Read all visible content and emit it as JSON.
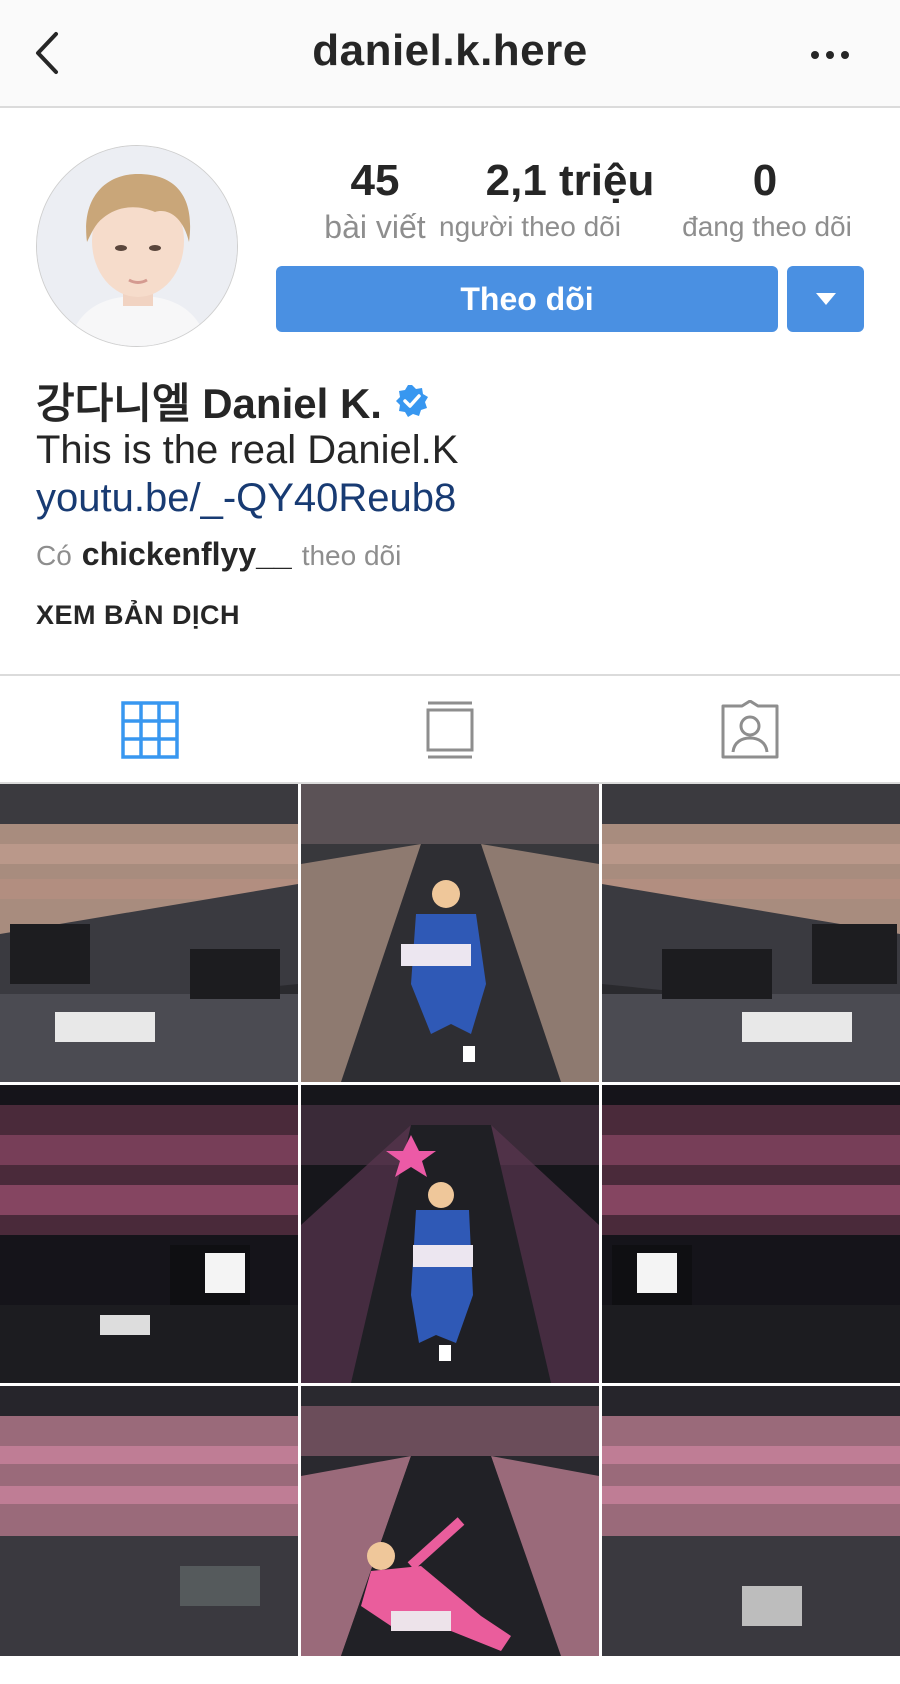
{
  "header": {
    "username": "daniel.k.here",
    "icons": {
      "back": "chevron-left-icon",
      "more": "more-horizontal-icon"
    }
  },
  "stats": {
    "posts": {
      "value": "45",
      "label": "bài viết"
    },
    "followers": {
      "value": "2,1 triệu",
      "label": "người theo dõi"
    },
    "following": {
      "value": "0",
      "label": "đang theo dõi"
    }
  },
  "actions": {
    "follow_label": "Theo dõi",
    "dropdown_icon": "caret-down-icon",
    "accent": "#4a90e2"
  },
  "profile": {
    "name": "강다니엘 Daniel K.",
    "verified_icon": "verified-badge-icon",
    "bio": "This is the real Daniel.K",
    "link": "youtu.be/_-QY40Reub8",
    "followed_prefix": "Có",
    "followed_user": "chickenflyy__",
    "followed_suffix": "theo dõi",
    "translate_label": "XEM BẢN DỊCH"
  },
  "tabs": [
    {
      "icon": "grid-icon",
      "active": true
    },
    {
      "icon": "feed-icon",
      "active": false
    },
    {
      "icon": "tagged-person-icon",
      "active": false
    }
  ],
  "posts": [
    {
      "scene": "concert-stage-wide"
    },
    {
      "scene": "performer-kneeling-blue-suit"
    },
    {
      "scene": "concert-stage-wide"
    },
    {
      "scene": "lightsticks-crowd"
    },
    {
      "scene": "performer-kneeling-star"
    },
    {
      "scene": "lightsticks-crowd"
    },
    {
      "scene": "crowd-banners"
    },
    {
      "scene": "performer-pink-suit"
    },
    {
      "scene": "crowd-banners"
    }
  ]
}
